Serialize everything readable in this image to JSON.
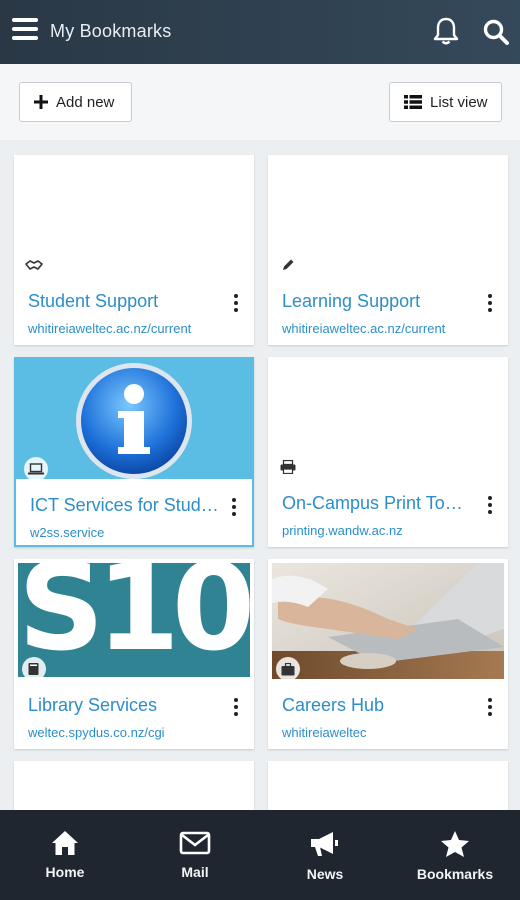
{
  "header": {
    "title": "My Bookmarks"
  },
  "toolbar": {
    "add_label": "Add new",
    "list_label": "List view"
  },
  "cards": [
    {
      "title": "Student Support",
      "url": "whitireiaweltec.ac.nz/current",
      "badge_icon": "handshake-icon"
    },
    {
      "title": "Learning Support",
      "url": "whitireiaweltec.ac.nz/current",
      "badge_icon": "pencil-icon"
    },
    {
      "title": "ICT Services for Stud…",
      "url": "w2ss.service",
      "badge_icon": "laptop-icon",
      "selected": true
    },
    {
      "title": "On-Campus Print To…",
      "url": "printing.wandw.ac.nz",
      "badge_icon": "printer-icon"
    },
    {
      "title": "Library Services",
      "url": "weltec.spydus.co.nz/cgi",
      "badge_icon": "book-icon",
      "thumb_text": "S10"
    },
    {
      "title": "Careers Hub",
      "url": "whitireiaweltec",
      "badge_icon": "briefcase-icon"
    }
  ],
  "nav": [
    {
      "label": "Home",
      "icon": "home-icon"
    },
    {
      "label": "Mail",
      "icon": "mail-icon"
    },
    {
      "label": "News",
      "icon": "megaphone-icon"
    },
    {
      "label": "Bookmarks",
      "icon": "star-icon"
    }
  ],
  "colors": {
    "header": "#2a3846",
    "link": "#2c8ec8",
    "nav_bg": "#1f2630",
    "selected_border": "#5bbde3"
  }
}
